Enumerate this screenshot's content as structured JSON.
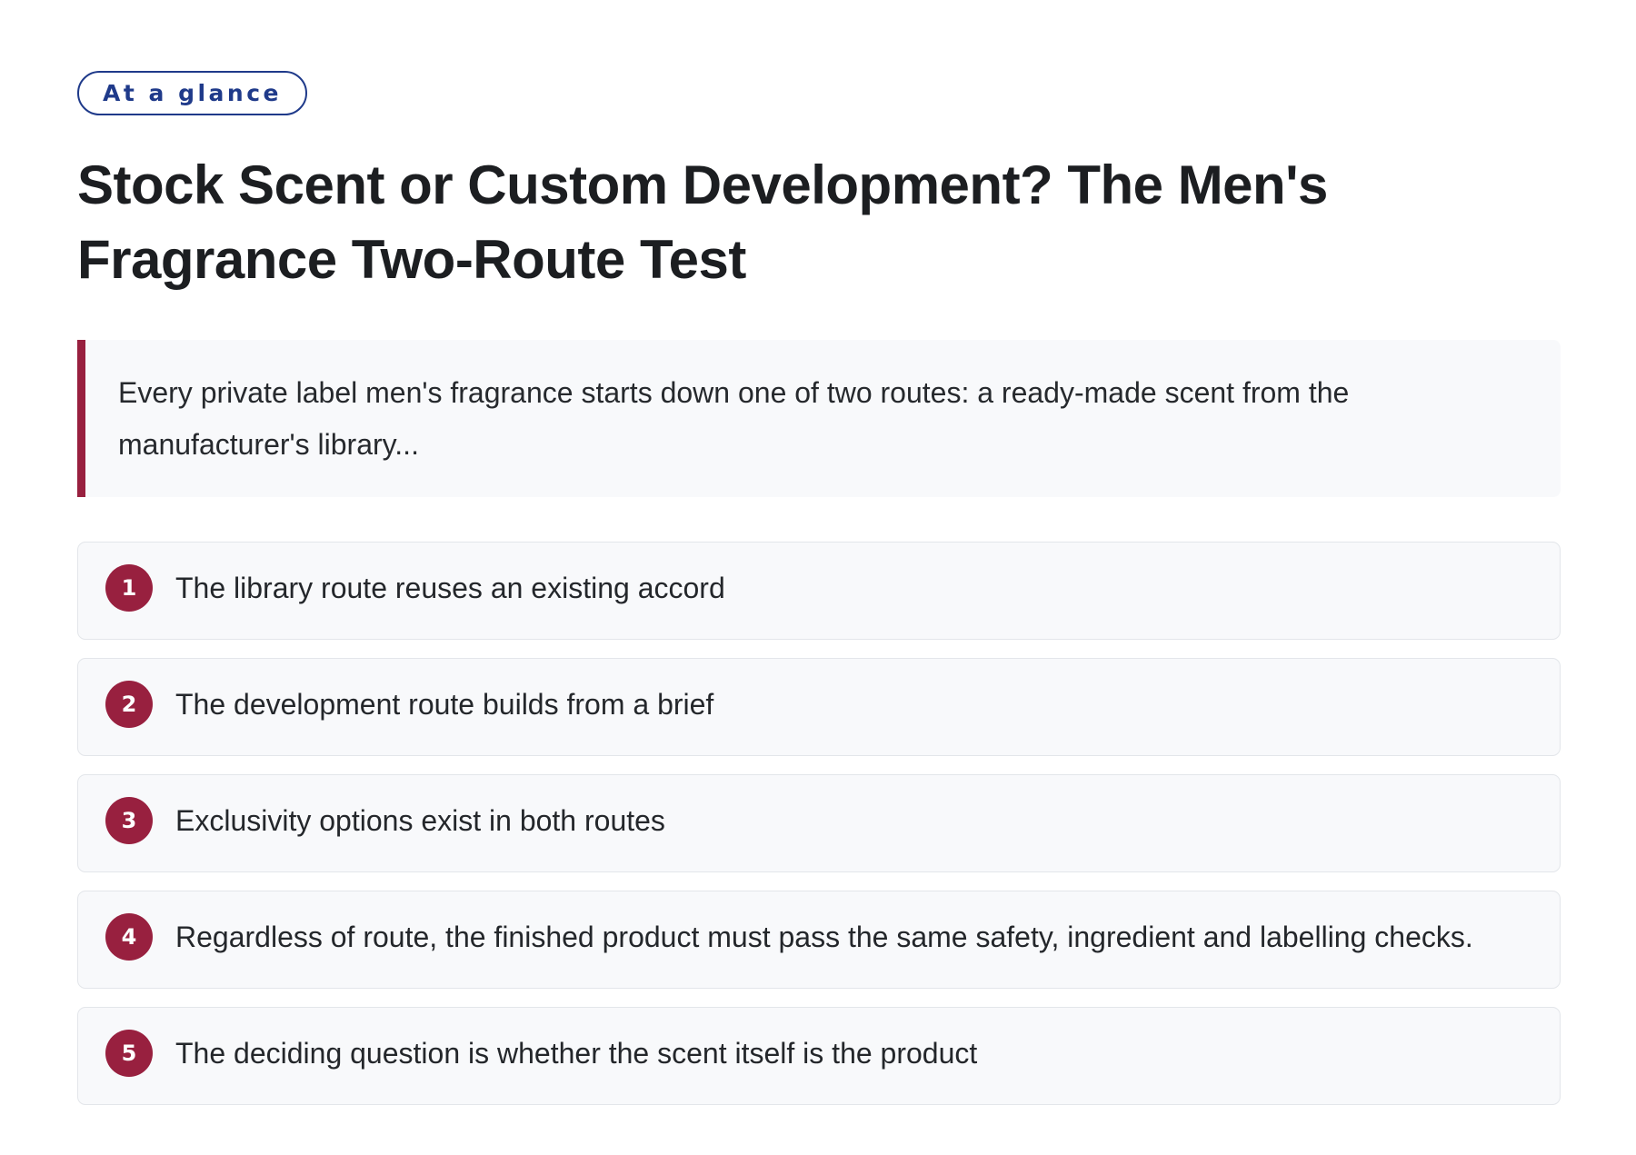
{
  "badge": "At a glance",
  "title": "Stock Scent or Custom Development? The Men's Fragrance Two-Route Test",
  "intro": "Every private label men's fragrance starts down one of two routes: a ready-made scent from the manufacturer's library...",
  "accent_color": "#98203f",
  "badge_color": "#1f3a8a",
  "items": [
    {
      "number": "1",
      "text": "The library route reuses an existing accord"
    },
    {
      "number": "2",
      "text": "The development route builds from a brief"
    },
    {
      "number": "3",
      "text": "Exclusivity options exist in both routes"
    },
    {
      "number": "4",
      "text": "Regardless of route, the finished product must pass the same safety, ingredient and labelling checks."
    },
    {
      "number": "5",
      "text": "The deciding question is whether the scent itself is the product"
    }
  ]
}
